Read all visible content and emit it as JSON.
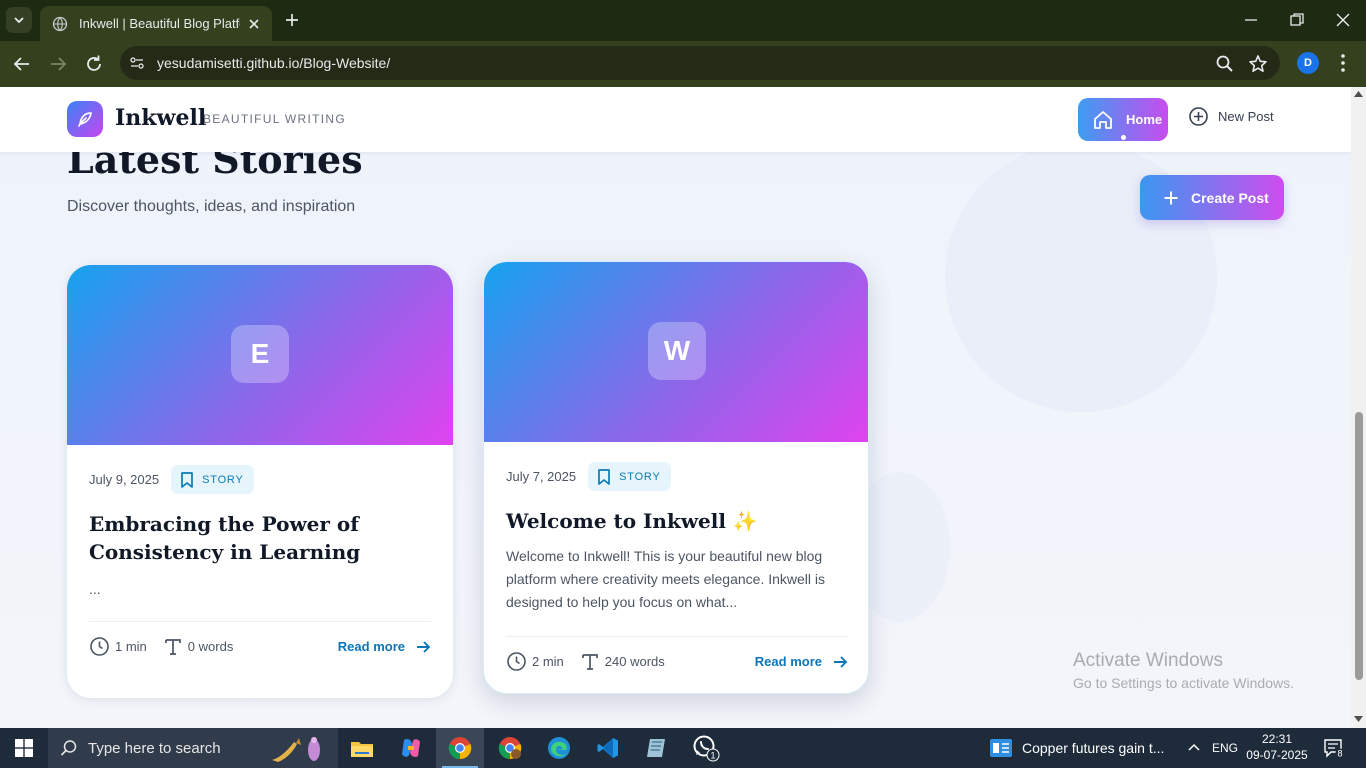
{
  "browser": {
    "tab_title": "Inkwell | Beautiful Blog Platform",
    "url_host": "yesudamisetti.github.io",
    "url_path": "/Blog-Website/",
    "profile_initial": "D"
  },
  "site": {
    "brand": "Inkwell",
    "tagline": "BEAUTIFUL WRITING",
    "nav": {
      "home": "Home",
      "new_post": "New Post"
    }
  },
  "main": {
    "title": "Latest Stories",
    "subtitle": "Discover thoughts, ideas, and inspiration",
    "create_button": "Create Post"
  },
  "posts": [
    {
      "initial": "E",
      "date": "July 9, 2025",
      "tag": "STORY",
      "title": "Embracing the Power of Consistency in Learning",
      "excerpt": "...",
      "read_time": "1 min",
      "words": "0 words",
      "read_more": "Read more"
    },
    {
      "initial": "W",
      "date": "July 7, 2025",
      "tag": "STORY",
      "title": "Welcome to Inkwell ✨",
      "excerpt": "Welcome to Inkwell! This is your beautiful new blog platform where creativity meets elegance. Inkwell is designed to help you focus on what...",
      "read_time": "2 min",
      "words": "240 words",
      "read_more": "Read more"
    }
  ],
  "watermark": {
    "line1": "Activate Windows",
    "line2": "Go to Settings to activate Windows."
  },
  "taskbar": {
    "search_placeholder": "Type here to search",
    "news": "Copper futures gain t...",
    "language": "ENG",
    "time": "22:31",
    "date": "09-07-2025",
    "notification_count": "8",
    "whatsapp_badge": "1"
  },
  "colors": {
    "accent_blue": "#3b97f0",
    "accent_magenta": "#cf4cee",
    "link": "#0c76b8",
    "tag_bg": "#e6f4fb"
  }
}
